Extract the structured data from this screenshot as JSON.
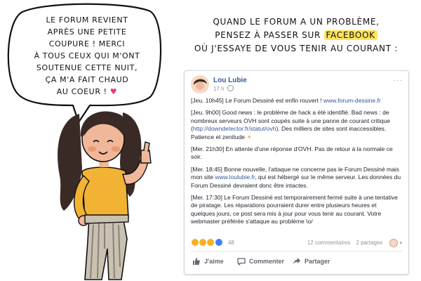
{
  "bubble": {
    "lines": [
      "LE FORUM REVIENT",
      "APRÈS UNE PETITE",
      "COUPURE ! MERCI",
      "À TOUS CEUX QUI M'ONT",
      "SOUTENUE CETTE NUIT,",
      "ÇA M'A FAIT CHAUD",
      "AU COEUR !"
    ],
    "heart": "♥"
  },
  "headline": {
    "line1": "QUAND LE FORUM A UN PROBLÈME,",
    "line2_pre": "PENSEZ À PASSER SUR ",
    "line2_highlight": "FACEBOOK",
    "line3": "OÙ J'ESSAYE DE VOUS TENIR AU COURANT :"
  },
  "post": {
    "author": "Lou Lubie",
    "time": "17 h",
    "more": "···",
    "entries": [
      {
        "prefix": "[Jeu. 10h45] Le Forum Dessiné est enfin rouvert ! ",
        "link": "www.forum-dessine.fr",
        "suffix": ""
      },
      {
        "prefix": "[Jeu. 9h00] Good news : le problème de hack a été identifié. Bad news : de nombreux serveurs OVH sont coupés suite à une panne de courant critique (",
        "link": "http://downdetector.fr/statut/ovh",
        "suffix": "). Des milliers de sites sont inaccessibles. Patience et zenitude "
      },
      {
        "prefix": "[Mer. 21h30] En attente d'une réponse d'OVH. Pas de retour à la normale ce soir.",
        "link": "",
        "suffix": ""
      },
      {
        "prefix": "[Mer. 18:45] Bonne nouvelle, l'attaque ne concerne pas le Forum Dessiné mais mon site ",
        "link": "www.loulubie.fr",
        "suffix": ", qui est hébergé sur le même serveur. Les données du Forum Dessiné devraient donc être intactes."
      },
      {
        "prefix": "[Mer. 17:30] Le Forum Dessiné est temporairement fermé suite à une tentative de piratage. Les réparations pourraient durer entre plusieurs heures et quelques jours, ce post sera mis à jour pour vous tenir au courant. Votre webmaster préférée s'attaque au problème \\o/",
        "link": "",
        "suffix": ""
      }
    ],
    "sun_emoji": "☀",
    "reaction_count": "48",
    "comments": "12 commentaires",
    "shares": "2 partages",
    "caret": "▾",
    "actions": {
      "like": "J'aime",
      "comment": "Commenter",
      "share": "Partager"
    }
  },
  "colors": {
    "link": "#365899",
    "highlight": "#ffe45c",
    "heart": "#e63b6c",
    "shirt": "#f2b233"
  }
}
